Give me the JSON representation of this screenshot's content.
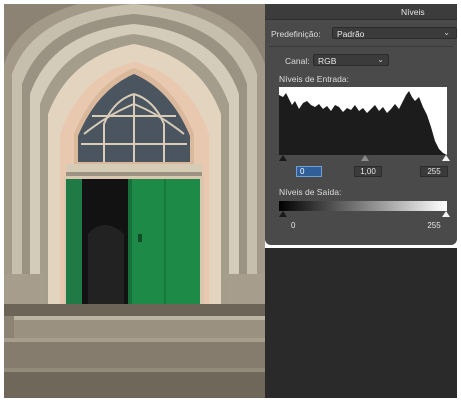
{
  "panel": {
    "title": "Níveis",
    "preset_label": "Predefinição:",
    "preset_value": "Padrão",
    "channel_label": "Canal:",
    "channel_value": "RGB",
    "input_levels_label": "Níveis de Entrada:",
    "input_black": "0",
    "input_gamma": "1,00",
    "input_white": "255",
    "output_levels_label": "Níveis de Saída:",
    "output_black": "0",
    "output_white": "255"
  },
  "icons": {
    "dropdown": "chevron-down-icon"
  },
  "colors": {
    "panel_bg": "#4a4a4a",
    "active_field": "#2f5f96",
    "door_green": "#1e8a47"
  }
}
